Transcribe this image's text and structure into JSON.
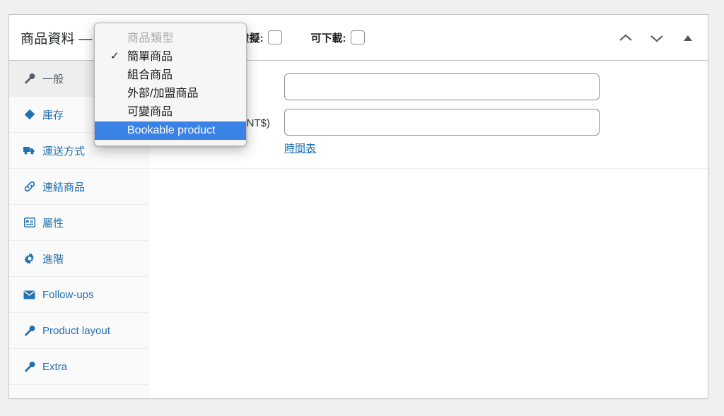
{
  "panel": {
    "title": "商品資料 —",
    "type_select_value": "簡單商品",
    "checkboxes": [
      {
        "label": "虛擬:",
        "checked": false,
        "name": "virtual"
      },
      {
        "label": "可下載:",
        "checked": false,
        "name": "downloadable"
      }
    ],
    "actions": [
      {
        "name": "move-up-button",
        "icon": "chevron-up-icon"
      },
      {
        "name": "move-down-button",
        "icon": "chevron-down-icon"
      },
      {
        "name": "toggle-panel-button",
        "icon": "triangle-up-icon"
      }
    ]
  },
  "tabs": [
    {
      "label": "一般",
      "icon": "wrench-icon",
      "active": true
    },
    {
      "label": "庫存",
      "icon": "tag-icon",
      "active": false
    },
    {
      "label": "運送方式",
      "icon": "truck-icon",
      "active": false
    },
    {
      "label": "連結商品",
      "icon": "link-icon",
      "active": false
    },
    {
      "label": "屬性",
      "icon": "attributes-icon",
      "active": false
    },
    {
      "label": "進階",
      "icon": "gear-icon",
      "active": false
    },
    {
      "label": "Follow-ups",
      "icon": "envelope-icon",
      "active": false
    },
    {
      "label": "Product layout",
      "icon": "wrench-icon",
      "active": false
    },
    {
      "label": "Extra",
      "icon": "wrench-icon",
      "active": false
    }
  ],
  "general_tab": {
    "regular_price": {
      "label": "",
      "value": "",
      "placeholder": ""
    },
    "sale_price": {
      "label": "折扣價 (NT$)",
      "value": "",
      "placeholder": ""
    },
    "schedule_link": "時間表"
  },
  "dropdown": {
    "header": "商品類型",
    "items": [
      {
        "label": "簡單商品",
        "checked": true,
        "highlighted": false
      },
      {
        "label": "組合商品",
        "checked": false,
        "highlighted": false
      },
      {
        "label": "外部/加盟商品",
        "checked": false,
        "highlighted": false
      },
      {
        "label": "可變商品",
        "checked": false,
        "highlighted": false
      },
      {
        "label": "Bookable product",
        "checked": false,
        "highlighted": true
      }
    ],
    "check_glyph": "✓"
  },
  "colors": {
    "accent": "#2271b1",
    "highlight": "#3b82e6",
    "panel_border": "#c3c4c7",
    "page_bg": "#f0f0f1"
  }
}
